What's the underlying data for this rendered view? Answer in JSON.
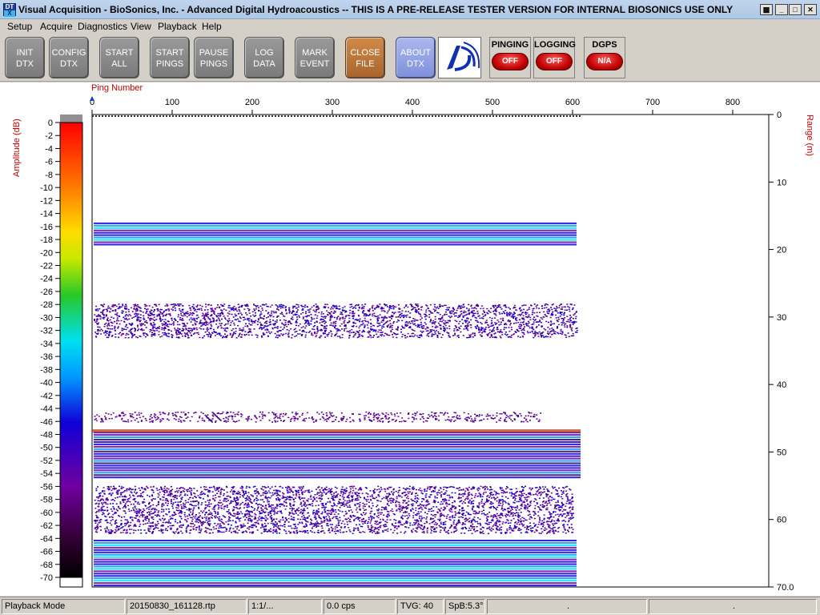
{
  "window": {
    "title": "Visual Acquisition  -  BioSonics, Inc.  -  Advanced Digital Hydroacoustics  -- THIS IS A PRE-RELEASE TESTER VERSION FOR INTERNAL BIOSONICS USE ONLY",
    "icon": "dtx-app-icon",
    "icon_text_top": "DT",
    "icon_text_bottom": "X",
    "controls": [
      "restore-icon",
      "minimize-icon",
      "maximize-icon",
      "close-icon"
    ]
  },
  "menu": {
    "items": [
      "Setup",
      "Acquire",
      "Diagnostics",
      "View",
      "Playback",
      "Help"
    ]
  },
  "toolbar": {
    "buttons": [
      {
        "label": "INIT\nDTX"
      },
      {
        "label": "CONFIG\nDTX"
      },
      {
        "label": "START\nALL"
      },
      {
        "label": "START\nPINGS"
      },
      {
        "label": "PAUSE\nPINGS"
      },
      {
        "label": "LOG\nDATA"
      },
      {
        "label": "MARK\nEVENT"
      },
      {
        "label": "CLOSE\nFILE"
      },
      {
        "label": "ABOUT\nDTX"
      }
    ],
    "indicators": [
      {
        "label": "PINGING",
        "state": "OFF"
      },
      {
        "label": "LOGGING",
        "state": "OFF"
      },
      {
        "label": "DGPS",
        "state": "N/A"
      }
    ],
    "colors": {
      "gray_button": "#8a8a8a",
      "close_button": "#b8763c",
      "about_button": "#8e9fe4",
      "lamp": "#d00000"
    }
  },
  "plot": {
    "x_axis_label": "Ping Number",
    "y_axis_label": "Range (m)",
    "colorbar_label": "Amplitude (dB)"
  },
  "chart_data": {
    "type": "heatmap",
    "description_free": true,
    "x_ticks": [
      0,
      100,
      200,
      300,
      400,
      500,
      600,
      700,
      800
    ],
    "y_ticks": [
      "0",
      "10",
      "20",
      "30",
      "40",
      "50",
      "60",
      "70.0"
    ],
    "x_range": [
      0,
      845
    ],
    "y_range": [
      0,
      70
    ],
    "colorbar_ticks": [
      0,
      -2,
      -4,
      -6,
      -8,
      -10,
      -12,
      -14,
      -16,
      -18,
      -20,
      -22,
      -24,
      -26,
      -28,
      -30,
      -32,
      -34,
      -36,
      -38,
      -40,
      -42,
      -44,
      -46,
      -48,
      -50,
      -52,
      -54,
      -56,
      -58,
      -60,
      -62,
      -64,
      -66,
      -68,
      -70
    ],
    "colorbar_range": [
      -70,
      0
    ],
    "pings_recorded": 610,
    "bands": [
      {
        "range_start": 16.0,
        "range_end": 19.5,
        "ping_end": 605,
        "strength": "strong"
      },
      {
        "range_start": 28.0,
        "range_end": 33.0,
        "ping_end": 605,
        "strength": "scatter"
      },
      {
        "range_start": 44.0,
        "range_end": 45.5,
        "ping_end": 560,
        "strength": "weak"
      },
      {
        "range_start": 47.0,
        "range_end": 54.0,
        "ping_end": 610,
        "strength": "bottom"
      },
      {
        "range_start": 55.0,
        "range_end": 62.0,
        "ping_end": 600,
        "strength": "scatter"
      },
      {
        "range_start": 63.0,
        "range_end": 70.0,
        "ping_end": 605,
        "strength": "strong"
      }
    ]
  },
  "status": {
    "mode": "Playback Mode",
    "file": "20150830_161128.rtp",
    "ratio": "1:1/...",
    "rate": "0.0 cps",
    "tvg": "TVG: 40",
    "spb": "SpB:5.3°",
    "p7": ".",
    "p8": "."
  }
}
